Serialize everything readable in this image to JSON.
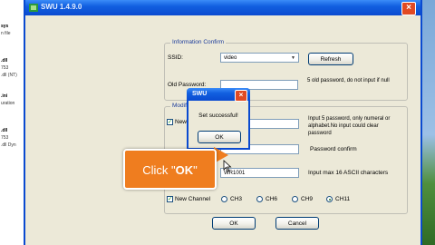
{
  "window": {
    "title": "SWU 1.4.9.0"
  },
  "left_strip": {
    "items": [
      {
        "text": "sys",
        "bold": true
      },
      {
        "text": "n file",
        "bold": false
      },
      {
        "text": ".dll",
        "bold": true
      },
      {
        "text": "753",
        "bold": false
      },
      {
        "text": ".dll (NT)",
        "bold": false
      },
      {
        "text": ".ini",
        "bold": true
      },
      {
        "text": "uration",
        "bold": false
      },
      {
        "text": ".dll",
        "bold": true
      },
      {
        "text": "753",
        "bold": false
      },
      {
        "text": ".dll Dyn",
        "bold": false
      }
    ]
  },
  "info_group": {
    "title": "Information Confirm",
    "ssid_label": "SSID:",
    "ssid_value": "video",
    "refresh_label": "Refresh",
    "old_password_label": "Old Password:",
    "old_password_value": "",
    "old_password_hint": "5 old password, do not input if null"
  },
  "modify_group": {
    "title": "Modify",
    "new_password_label": "New P",
    "new_password_hint": "Input 5 password, only numeral or alphabet.No input could clear password",
    "confirm_hint": "Password confirm",
    "ssid_value": "WR1001",
    "ssid_hint": "Input max 16 ASCII characters",
    "new_channel_label": "New Channel",
    "channels": [
      "CH3",
      "CH6",
      "CH9",
      "CH11"
    ],
    "selected_channel": "CH11"
  },
  "buttons": {
    "ok": "OK",
    "cancel": "Cancel"
  },
  "popup": {
    "title": "SWU",
    "message": "Set successful!",
    "ok": "OK",
    "close": "×"
  },
  "callout": {
    "prefix": "Click \"",
    "bold": "OK",
    "suffix": "\""
  },
  "colors": {
    "accent": "#0a4ad0",
    "callout": "#ef7d1f"
  }
}
